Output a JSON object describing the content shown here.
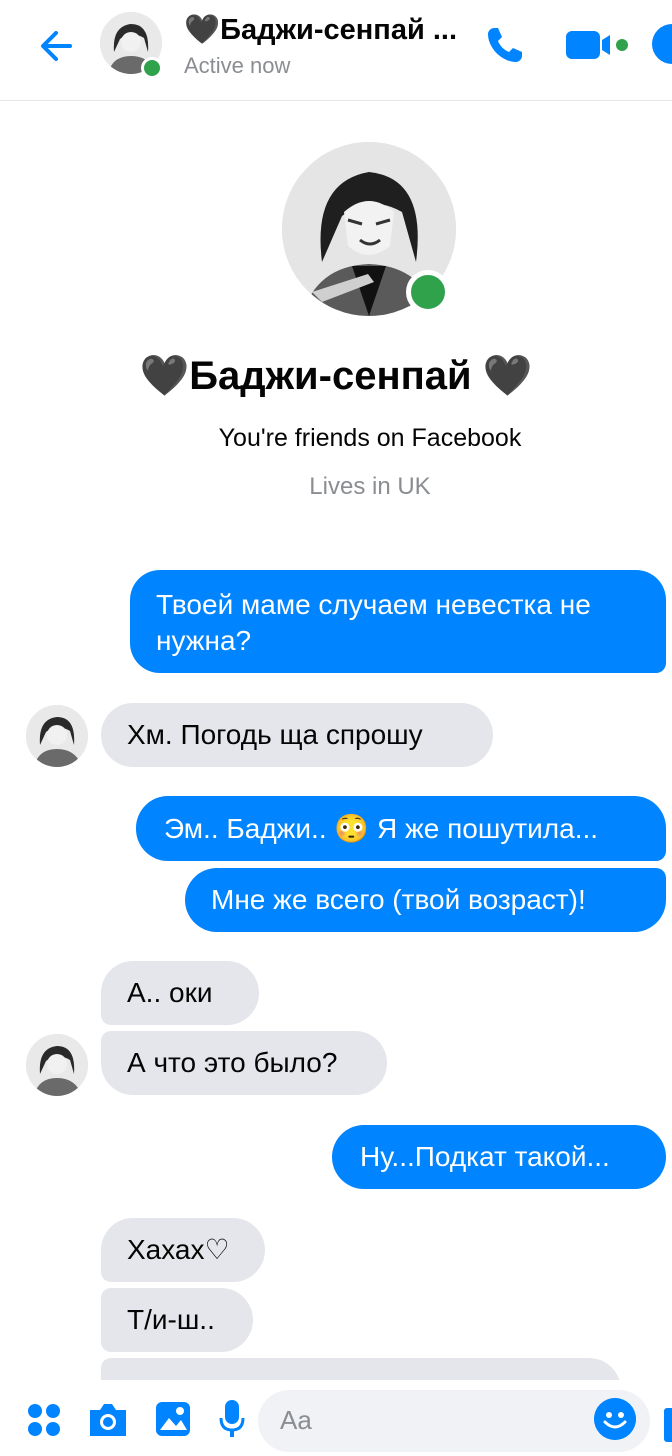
{
  "header": {
    "name": "🖤Баджи-сенпай ...",
    "status": "Active now"
  },
  "profile": {
    "name": "🖤Баджи-сенпай 🖤",
    "friends_text": "You're friends on Facebook",
    "location": "Lives in UK"
  },
  "messages": [
    {
      "text": "Твоей маме случаем невестка не нужна?",
      "direction": "outgoing"
    },
    {
      "text": "Хм. Погодь ща спрошу",
      "direction": "incoming"
    },
    {
      "text": "Эм.. Баджи.. 😳 Я же пошутила...",
      "direction": "outgoing"
    },
    {
      "text": "Мне же всего (твой возраст)!",
      "direction": "outgoing"
    },
    {
      "text": "А.. оки",
      "direction": "incoming"
    },
    {
      "text": "А что это было?",
      "direction": "incoming"
    },
    {
      "text": "Ну...Подкат такой...",
      "direction": "outgoing"
    },
    {
      "text": "Хахах♡",
      "direction": "incoming"
    },
    {
      "text": "Т/и-ш..",
      "direction": "incoming"
    }
  ],
  "composer": {
    "placeholder": "Aa"
  },
  "colors": {
    "accent": "#0084ff",
    "online": "#31a24c",
    "incoming_bubble": "#e4e6eb"
  }
}
